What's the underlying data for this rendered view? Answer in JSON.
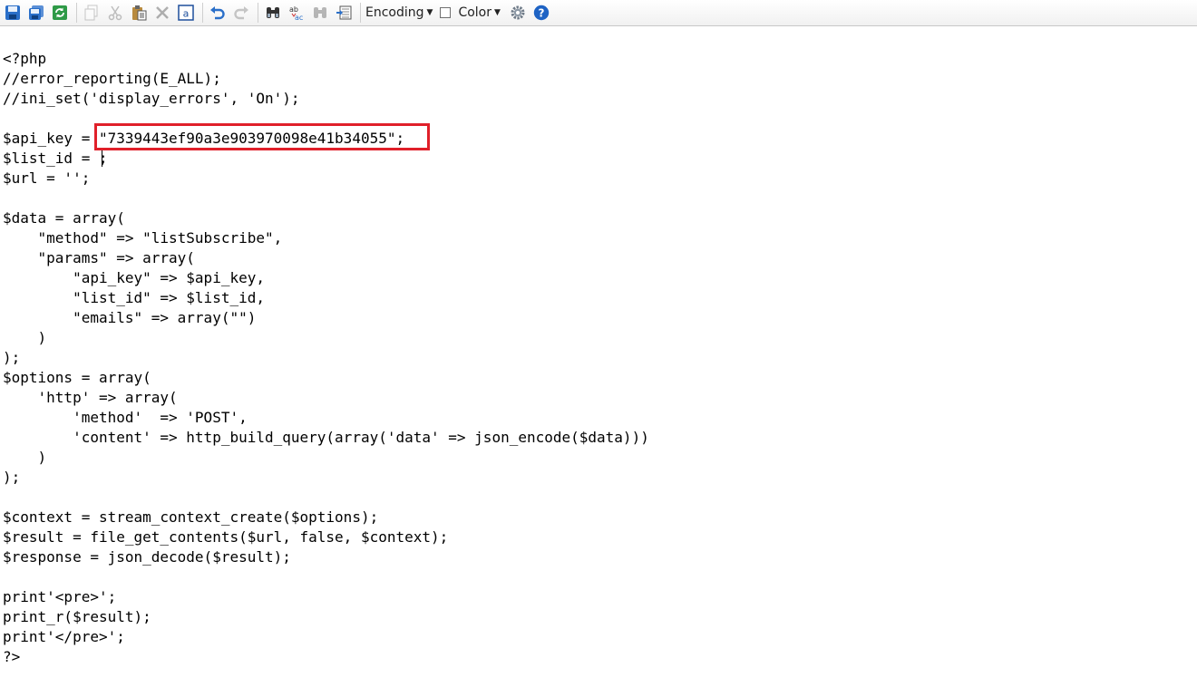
{
  "toolbar": {
    "buttons": [
      {
        "name": "save-icon"
      },
      {
        "name": "save-all-icon"
      },
      {
        "name": "reload-icon"
      },
      {
        "name": "copy-icon"
      },
      {
        "name": "cut-icon"
      },
      {
        "name": "paste-icon"
      },
      {
        "name": "delete-icon"
      },
      {
        "name": "select-all-icon"
      },
      {
        "name": "undo-icon"
      },
      {
        "name": "redo-icon"
      },
      {
        "name": "find-icon"
      },
      {
        "name": "replace-icon"
      },
      {
        "name": "find-next-icon"
      },
      {
        "name": "goto-icon"
      }
    ],
    "encoding_label": "Encoding",
    "color_label": "Color",
    "settings_icon": "gear-icon",
    "help_icon": "help-icon",
    "accent_color": "#2a6fc9",
    "help_color": "#1e63c4"
  },
  "editor": {
    "highlight_color": "#e0202a",
    "lines": [
      "<?php",
      "//error_reporting(E_ALL);",
      "//ini_set('display_errors', 'On');",
      "",
      "$api_key = \"7339443ef90a3e903970098e41b34055\";",
      "$list_id = ;",
      "$url = '';",
      "",
      "$data = array(",
      "    \"method\" => \"listSubscribe\",",
      "    \"params\" => array(",
      "        \"api_key\" => $api_key,",
      "        \"list_id\" => $list_id,",
      "        \"emails\" => array(\"\")",
      "    )",
      ");",
      "$options = array(",
      "    'http' => array(",
      "        'method'  => 'POST',",
      "        'content' => http_build_query(array('data' => json_encode($data)))",
      "    )",
      ");",
      "",
      "$context = stream_context_create($options);",
      "$result = file_get_contents($url, false, $context);",
      "$response = json_decode($result);",
      "",
      "print'<pre>';",
      "print_r($result);",
      "print'</pre>';",
      "?>"
    ]
  }
}
